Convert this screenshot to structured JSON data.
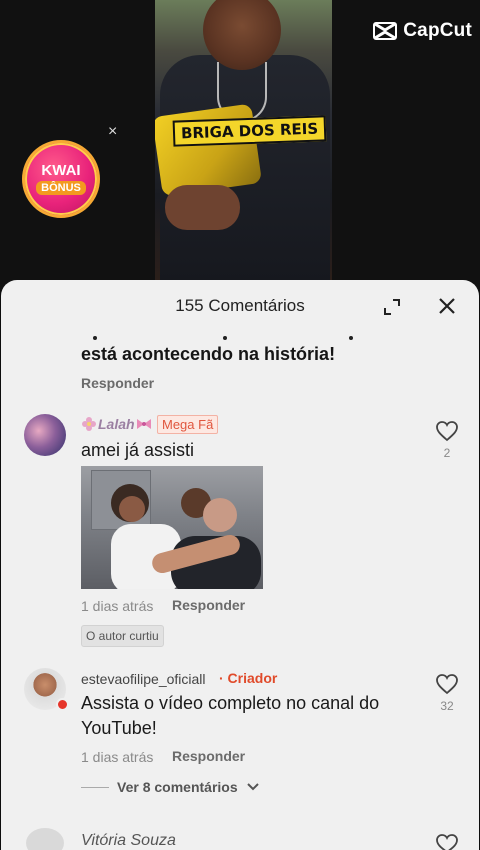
{
  "video": {
    "watermark": "CapCut",
    "overlay_title": "BRIGA DOS REIS"
  },
  "ad_badge": {
    "line1": "KWAI",
    "line2": "BÔNUS",
    "close": "×"
  },
  "sheet": {
    "title": "155 Comentários"
  },
  "previous_comment": {
    "text": "está acontecendo na história!",
    "reply_label": "Responder"
  },
  "comments": [
    {
      "username": "Lalah",
      "badge": "Mega Fã",
      "text": "amei já assisti",
      "time": "1 dias atrás",
      "reply_label": "Responder",
      "author_liked": "O autor curtiu",
      "likes": "2"
    },
    {
      "username": "estevaofilipe_oficiall",
      "badge": "· Criador",
      "text_line1": "Assista o vídeo completo no canal do",
      "text_line2": "YouTube!",
      "time": "1 dias atrás",
      "reply_label": "Responder",
      "likes": "32",
      "see_more": "Ver 8 comentários"
    },
    {
      "username": "Vitória Souza"
    }
  ],
  "colors": {
    "sheet_bg": "#f0f0f0",
    "creator_accent": "#e04a2a",
    "badge_accent": "#e0563e",
    "kwai_pink": "#e9237b"
  }
}
